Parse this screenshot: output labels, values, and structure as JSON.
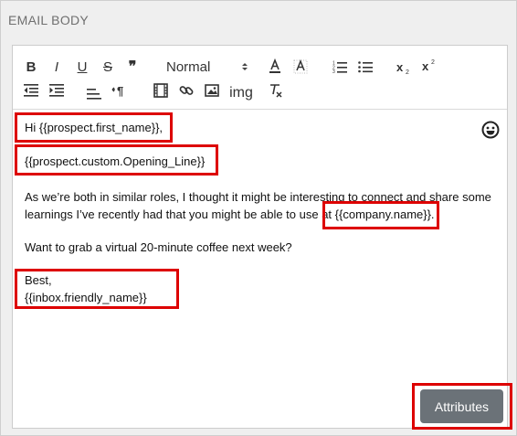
{
  "section_title": "EMAIL BODY",
  "toolbar": {
    "bold_label": "B",
    "italic_label": "I",
    "underline_label": "U",
    "strike_label": "S",
    "quote_label": "❞",
    "heading_select": "Normal",
    "img_label": "img",
    "icons": [
      "bold-icon",
      "italic-icon",
      "underline-icon",
      "strike-icon",
      "blockquote-icon",
      "font-color-icon",
      "background-color-icon",
      "ordered-list-icon",
      "bullet-list-icon",
      "subscript-icon",
      "superscript-icon",
      "outdent-icon",
      "indent-icon",
      "align-icon",
      "text-direction-icon",
      "video-icon",
      "link-icon",
      "image-icon",
      "clear-format-icon"
    ]
  },
  "body": {
    "greeting": "Hi {{prospect.first_name}},",
    "opening": "{{prospect.custom.Opening_Line}}",
    "para1_a": "As we’re both in similar roles, I thought it might be interesting to connect and share some",
    "para1_b": "learnings I’ve recently had that you might be able to use at {{company.name}}.",
    "para2": "Want to grab a virtual 20-minute coffee next week?",
    "sign_off": "Best,",
    "signature": "{{inbox.friendly_name}}"
  },
  "attributes_button": "Attributes",
  "colors": {
    "highlight": "#dd0000",
    "button_bg": "#6b7278"
  }
}
